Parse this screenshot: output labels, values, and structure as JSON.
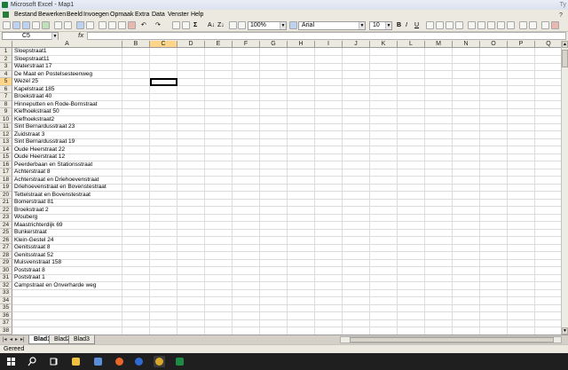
{
  "window": {
    "title": "Microsoft Excel - Map1",
    "title_suffix": "Ty"
  },
  "menu": {
    "items": [
      "Bestand",
      "Bewerken",
      "Beeld",
      "Invoegen",
      "Opmaak",
      "Extra",
      "Data",
      "Venster",
      "Help"
    ],
    "help_label": "?"
  },
  "toolbar": {
    "zoom": "100%",
    "font_name": "Arial",
    "font_size": "10",
    "bold": "B",
    "italic": "I",
    "underline": "U",
    "sum": "Σ",
    "sort_asc": "A↓",
    "sort_desc": "Z↓",
    "undo": "↶",
    "redo": "↷"
  },
  "formula_bar": {
    "name_box": "C5",
    "fx": "fx",
    "content": ""
  },
  "sheet": {
    "columns": [
      "A",
      "B",
      "C",
      "D",
      "E",
      "F",
      "G",
      "H",
      "I",
      "J",
      "K",
      "L",
      "M",
      "N",
      "O",
      "P",
      "Q"
    ],
    "row_numbers": [
      "1",
      "2",
      "3",
      "4",
      "5",
      "6",
      "7",
      "8",
      "9",
      "10",
      "11",
      "12",
      "13",
      "14",
      "15",
      "16",
      "17",
      "18",
      "19",
      "20",
      "21",
      "22",
      "23",
      "24",
      "25",
      "26",
      "27",
      "28",
      "29",
      "30",
      "31",
      "32",
      "33",
      "34",
      "35",
      "36",
      "37",
      "38",
      "39"
    ],
    "col_a_values": [
      "Sloepstraat1",
      "Sloepstraat11",
      "Waterstraat 17",
      "De Maat en Postelsesteenweg",
      "Wezel 25",
      "Kapelstraat 185",
      "Broekstraat 40",
      "Hinneputten en Rode-Bornstraat",
      "Kiefhoekstraat 50",
      "Kiefhoekstraat2",
      "Sint Bernardusstraat 23",
      "Zuidstraat 3",
      "Sint Bernardusstraat 19",
      "Oude Heerstraat 22",
      "Oude Heerstraat 12",
      "Peerderbaan en Stationsstraat",
      "Achterstraat 8",
      "Achterstraat en Driehoevenstraat",
      "Driehoevenstraat en Bovenstestraat",
      "Tettelstraat en Bovenstestraat",
      "Bomerstraat 81",
      "Broekstraat 2",
      "Wouberg",
      "Maastrichterdijk 69",
      "Bunkerstraat",
      "Klein-Gestel 24",
      "Genitsstraat 8",
      "Genitsstraat 52",
      "Muisvenstraat 158",
      "Poststraat 8",
      "Poststraat 1",
      "Campstraat en Onverharde weg"
    ]
  },
  "sheet_tabs": [
    "Blad1",
    "Blad2",
    "Blad3"
  ],
  "tab_nav": [
    "|◂",
    "◂",
    "▸",
    "▸|"
  ],
  "status": {
    "text": "Gereed"
  },
  "taskbar": {
    "icons": [
      "windows-start",
      "search",
      "task-view",
      "file-explorer",
      "firefox",
      "chrome",
      "app",
      "excel"
    ]
  }
}
